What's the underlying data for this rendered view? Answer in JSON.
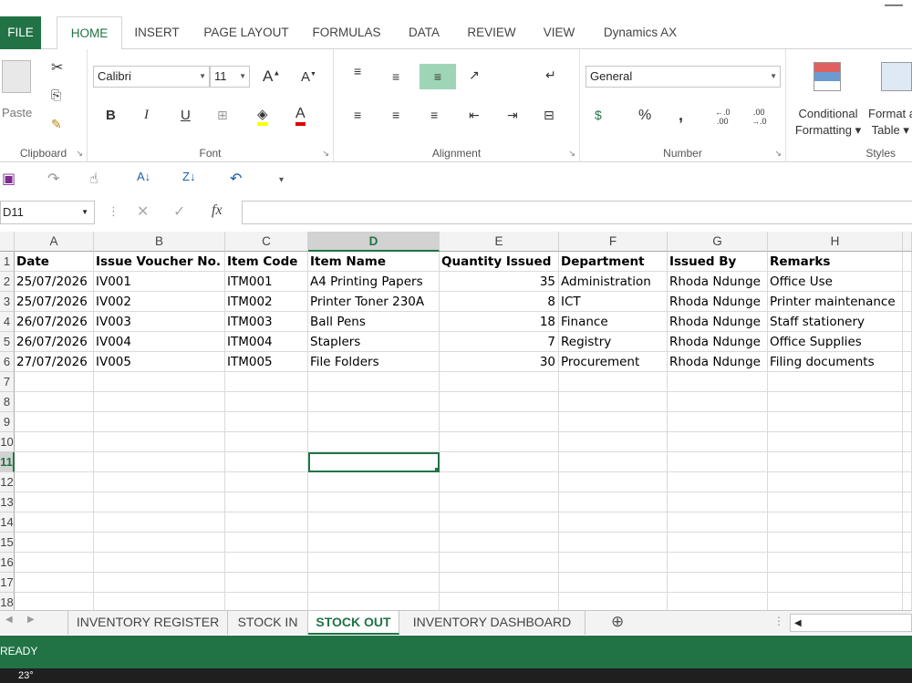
{
  "tabs": [
    "FILE",
    "HOME",
    "INSERT",
    "PAGE LAYOUT",
    "FORMULAS",
    "DATA",
    "REVIEW",
    "VIEW",
    "Dynamics AX"
  ],
  "ribbon": {
    "clipboard": {
      "label": "Clipboard",
      "paste": "Paste"
    },
    "font": {
      "label": "Font",
      "name": "Calibri",
      "size": "11"
    },
    "alignment": {
      "label": "Alignment"
    },
    "number": {
      "label": "Number",
      "format": "General"
    },
    "styles": {
      "label": "Styles",
      "conditional_1": "Conditional",
      "conditional_2": "Formatting",
      "format_table_1": "Format a",
      "format_table_2": "Table"
    }
  },
  "namebox": "D11",
  "columns": [
    "A",
    "B",
    "C",
    "D",
    "E",
    "F",
    "G",
    "H"
  ],
  "rows": [
    "1",
    "2",
    "3",
    "4",
    "5",
    "6",
    "7",
    "8",
    "9",
    "10",
    "11",
    "12",
    "13",
    "14",
    "15",
    "16",
    "17",
    "18"
  ],
  "headers": [
    "Date",
    "Issue Voucher No.",
    "Item Code",
    "Item Name",
    "Quantity Issued",
    "Department",
    "Issued By",
    "Remarks"
  ],
  "data": [
    [
      "25/07/2026",
      "IV001",
      "ITM001",
      "A4 Printing Papers",
      "35",
      "Administration",
      "Rhoda Ndunge",
      "Office Use"
    ],
    [
      "25/07/2026",
      "IV002",
      "ITM002",
      "Printer Toner 230A",
      "8",
      "ICT",
      "Rhoda Ndunge",
      "Printer maintenance"
    ],
    [
      "26/07/2026",
      "IV003",
      "ITM003",
      "Ball Pens",
      "18",
      "Finance",
      "Rhoda Ndunge",
      "Staff stationery"
    ],
    [
      "26/07/2026",
      "IV004",
      "ITM004",
      "Staplers",
      "7",
      "Registry",
      "Rhoda Ndunge",
      "Office Supplies"
    ],
    [
      "27/07/2026",
      "IV005",
      "ITM005",
      "File Folders",
      "30",
      "Procurement",
      "Rhoda Ndunge",
      "Filing documents"
    ]
  ],
  "sheets": [
    "INVENTORY REGISTER",
    "STOCK IN",
    "STOCK OUT",
    "INVENTORY DASHBOARD"
  ],
  "status": "READY",
  "weather": "23°",
  "colors": {
    "accent": "#217346"
  }
}
